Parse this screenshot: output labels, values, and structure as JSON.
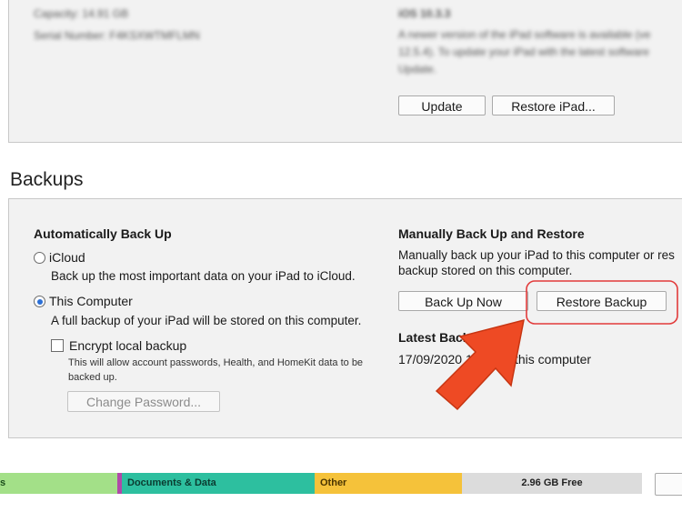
{
  "device_info": {
    "capacity_label": "Capacity:",
    "capacity_value": "14.91 GB",
    "serial_label": "Serial Number:",
    "serial_value": "F4KSXWTMFLMN",
    "ios_version": "iOS 10.3.3",
    "update_text_line1": "A newer version of the iPad software is available (ve",
    "update_text_line2": "12.5.4). To update your iPad with the latest software",
    "update_text_line3": "Update."
  },
  "top_buttons": {
    "update": "Update",
    "restore_ipad": "Restore iPad..."
  },
  "backups": {
    "title": "Backups",
    "auto": {
      "heading": "Automatically Back Up",
      "icloud_label": "iCloud",
      "icloud_desc": "Back up the most important data on your iPad to iCloud.",
      "computer_label": "This Computer",
      "computer_desc": "A full backup of your iPad will be stored on this computer.",
      "encrypt_label": "Encrypt local backup",
      "encrypt_desc_line1": "This will allow account passwords, Health, and HomeKit data to be",
      "encrypt_desc_line2": "backed up.",
      "change_password": "Change Password..."
    },
    "manual": {
      "heading": "Manually Back Up and Restore",
      "desc_line1": "Manually back up your iPad to this computer or res",
      "desc_line2": "backup stored on this computer.",
      "back_up_now": "Back Up Now",
      "restore_backup": "Restore Backup",
      "latest_label": "Latest Backup:",
      "latest_value": "17/09/2020 1",
      "latest_suffix": "this computer"
    }
  },
  "storage": {
    "segments": [
      {
        "label": "s",
        "color": "#a3e088"
      },
      {
        "label": "",
        "color": "#b04aa8"
      },
      {
        "label": "Documents & Data",
        "color": "#2dbf9f"
      },
      {
        "label": "Other",
        "color": "#f5c23a"
      },
      {
        "label": "2.96 GB Free",
        "color": "#dcdcdc"
      }
    ]
  },
  "colors": {
    "highlight": "#e23b3b",
    "arrow": "#ee4a24",
    "selected_radio": "#2b6fd6"
  }
}
